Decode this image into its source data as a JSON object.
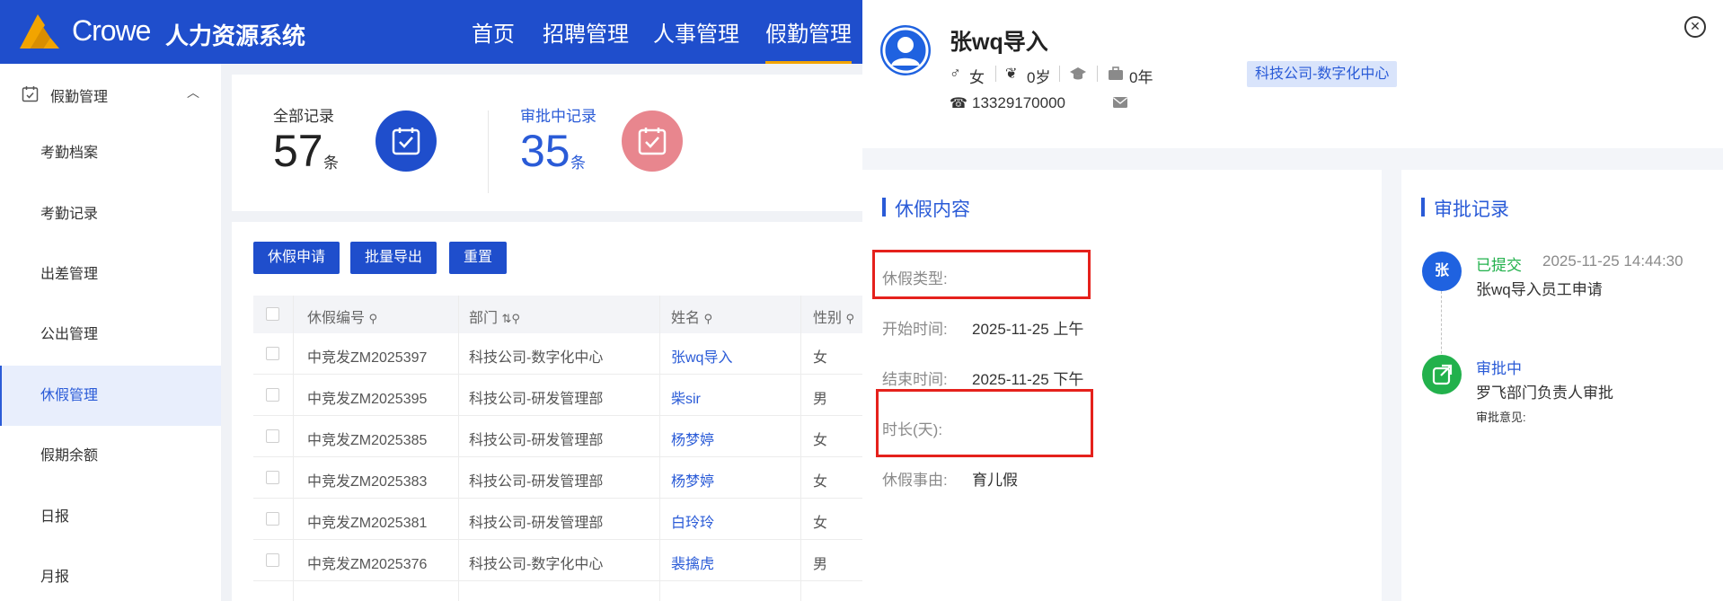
{
  "app": {
    "brand": "Crowe",
    "system_name": "人力资源系统",
    "colors": {
      "primary": "#1f4ecc",
      "accent": "#f2a400",
      "link": "#2a5bd7",
      "success": "#22b14c",
      "alert": "#e5211c",
      "pink": "#e8868e"
    }
  },
  "topnav": {
    "items": [
      {
        "label": "首页"
      },
      {
        "label": "招聘管理"
      },
      {
        "label": "人事管理"
      },
      {
        "label": "假勤管理",
        "active": true
      }
    ]
  },
  "sidebar": {
    "group_label": "假勤管理",
    "items": [
      {
        "label": "考勤档案"
      },
      {
        "label": "考勤记录"
      },
      {
        "label": "出差管理"
      },
      {
        "label": "公出管理"
      },
      {
        "label": "休假管理",
        "active": true
      },
      {
        "label": "假期余额"
      },
      {
        "label": "日报"
      },
      {
        "label": "月报"
      }
    ]
  },
  "stats": {
    "all": {
      "label": "全部记录",
      "value": "57",
      "unit": "条"
    },
    "pending": {
      "label": "审批中记录",
      "value": "35",
      "unit": "条"
    }
  },
  "toolbar": {
    "apply": "休假申请",
    "export": "批量导出",
    "reset": "重置"
  },
  "table": {
    "columns": [
      "休假编号",
      "部门",
      "姓名",
      "性别"
    ],
    "rows": [
      {
        "id": "中竞发ZM2025397",
        "dept": "科技公司-数字化中心",
        "name": "张wq导入",
        "gender": "女"
      },
      {
        "id": "中竞发ZM2025395",
        "dept": "科技公司-研发管理部",
        "name": "柴sir",
        "gender": "男"
      },
      {
        "id": "中竞发ZM2025385",
        "dept": "科技公司-研发管理部",
        "name": "杨梦婷",
        "gender": "女"
      },
      {
        "id": "中竞发ZM2025383",
        "dept": "科技公司-研发管理部",
        "name": "杨梦婷",
        "gender": "女"
      },
      {
        "id": "中竞发ZM2025381",
        "dept": "科技公司-研发管理部",
        "name": "白玲玲",
        "gender": "女"
      },
      {
        "id": "中竞发ZM2025376",
        "dept": "科技公司-数字化中心",
        "name": "裴擒虎",
        "gender": "男"
      }
    ]
  },
  "drawer": {
    "person": {
      "name": "张wq导入",
      "gender": "女",
      "age": "0岁",
      "tenure": "0年",
      "phone": "13329170000",
      "dept": "科技公司-数字化中心"
    },
    "leave": {
      "title": "休假内容",
      "fields": [
        {
          "label": "休假类型:",
          "value": ""
        },
        {
          "label": "开始时间:",
          "value": "2025-11-25 上午"
        },
        {
          "label": "结束时间:",
          "value": "2025-11-25 下午"
        },
        {
          "label": "时长(天):",
          "value": ""
        },
        {
          "label": "休假事由:",
          "value": "育儿假"
        }
      ]
    },
    "approval": {
      "title": "审批记录",
      "steps": [
        {
          "avatar": "张",
          "status": "已提交",
          "time": "2025-11-25 14:44:30",
          "desc": "张wq导入员工申请"
        },
        {
          "status": "审批中",
          "desc": "罗飞部门负责人审批",
          "opinion_label": "审批意见:"
        }
      ]
    }
  }
}
